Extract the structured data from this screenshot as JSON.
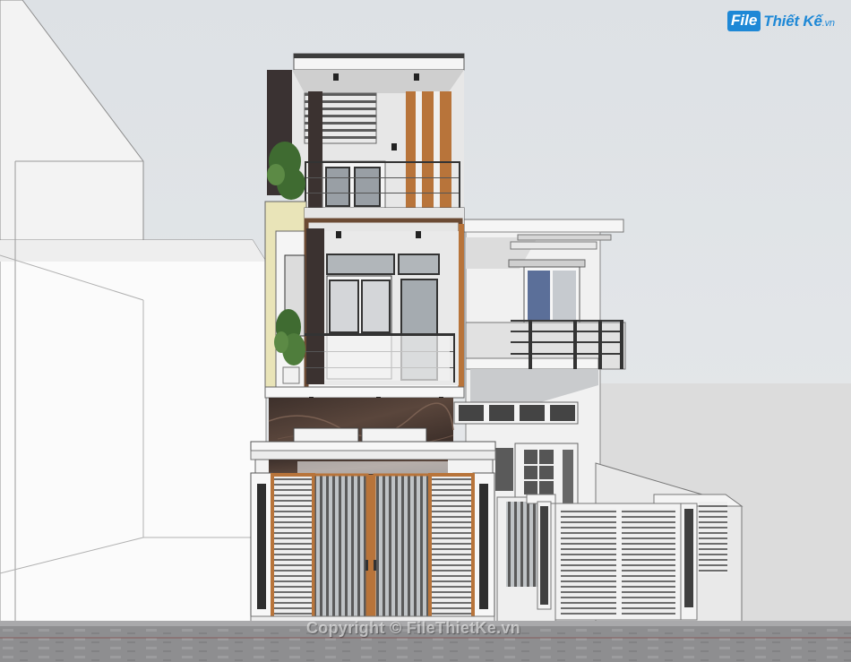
{
  "image": {
    "type": "3d-architectural-render",
    "palette": {
      "sky": "#e2e5e8",
      "wall_white": "#f7f7f7",
      "wall_shadow": "#c8ccce",
      "dark_wood": "#3b3230",
      "wood_accent": "#b8743a",
      "marble": "#4a3a33",
      "glass": "#a9b0b6",
      "railing": "#3b3b3b",
      "plant": "#3f6b31",
      "road": "#8f8f91"
    }
  },
  "logo": {
    "brand_box": "File",
    "brand_rest": "Thiết Kế",
    "brand_domain": ".vn",
    "color": "#1e88d6"
  },
  "watermark": {
    "text": "Copyright © FileThietKe.vn"
  }
}
